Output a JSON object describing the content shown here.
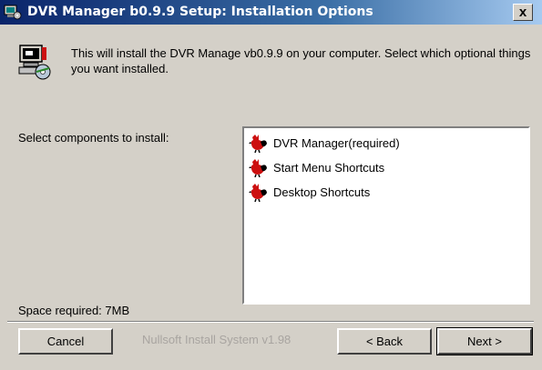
{
  "window": {
    "title": "DVR Manager b0.9.9 Setup: Installation Options",
    "close_label": "x"
  },
  "header": {
    "text": "This will install the   DVR Manage vb0.9.9 on your computer. Select which optional things you want installed."
  },
  "components": {
    "label": "Select components to install:",
    "items": [
      {
        "label": "DVR Manager(required)"
      },
      {
        "label": "Start Menu Shortcuts"
      },
      {
        "label": "Desktop Shortcuts"
      }
    ]
  },
  "space": {
    "label": "Space required: 7MB"
  },
  "footer": {
    "cancel_label": "Cancel",
    "branding": "Nullsoft Install System v1.98",
    "back_label": "< Back",
    "next_label": "Next >"
  },
  "colors": {
    "titlebar_start": "#0a246a",
    "titlebar_end": "#a6caf0",
    "dialog_bg": "#d4d0c8",
    "rooster_red": "#cc1010"
  },
  "icons": [
    "installer-icon",
    "computer-disk-icon",
    "rooster-icon",
    "close-icon"
  ]
}
